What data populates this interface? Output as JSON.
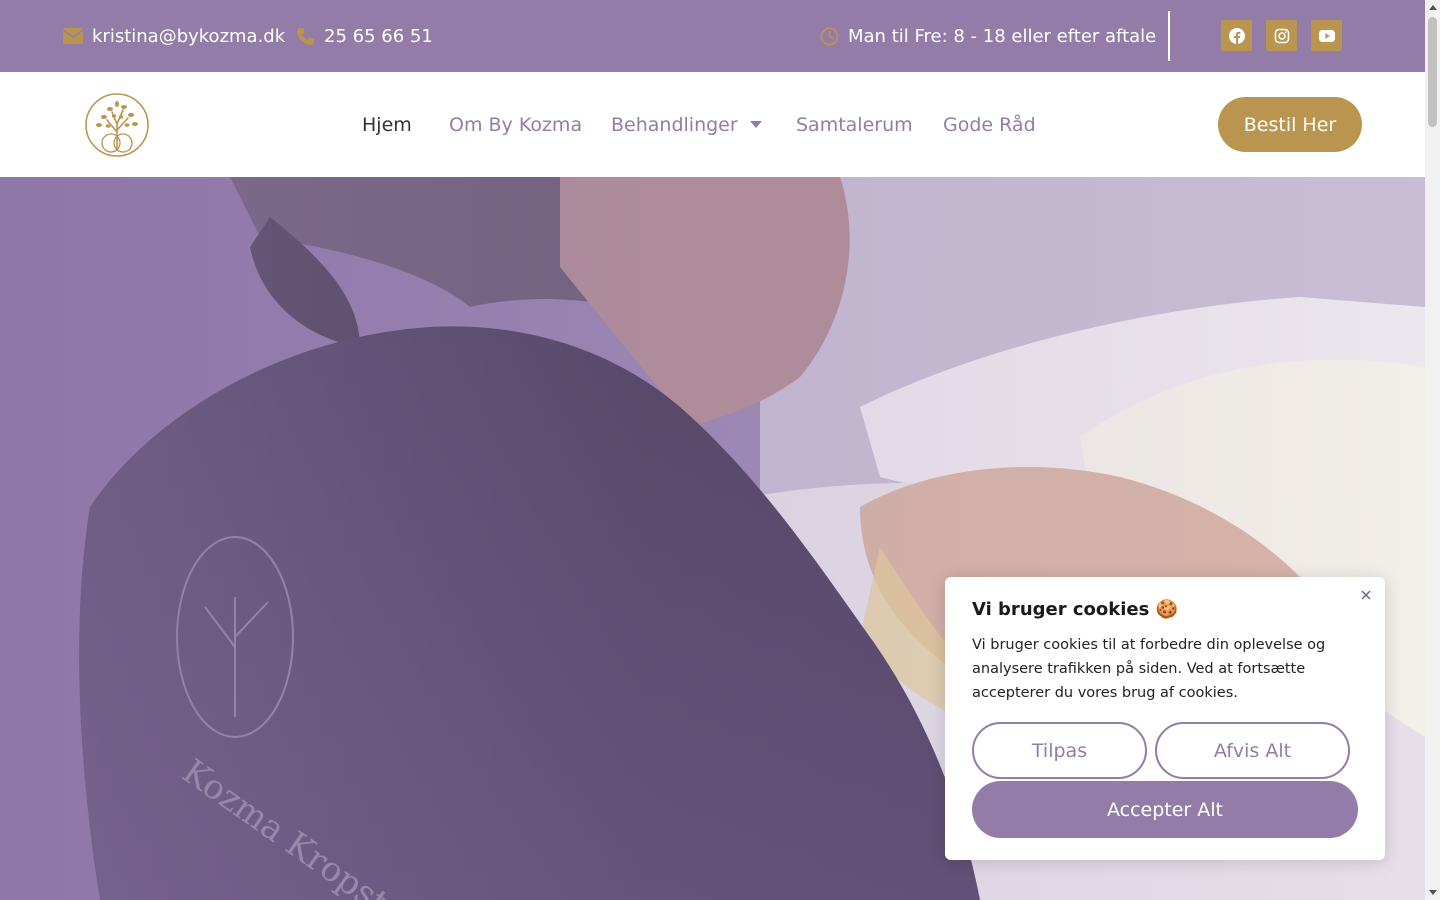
{
  "topbar": {
    "email": "kristina@bykozma.dk",
    "phone": "25 65 66 51",
    "hours": "Man til Fre: 8 - 18 eller efter aftale",
    "social": [
      "facebook-icon",
      "instagram-icon",
      "youtube-icon"
    ]
  },
  "nav": {
    "items": [
      {
        "label": "Hjem",
        "active": true
      },
      {
        "label": "Om By Kozma"
      },
      {
        "label": "Behandlinger",
        "has_dropdown": true
      },
      {
        "label": "Samtalerum"
      },
      {
        "label": "Gode Råd"
      }
    ],
    "cta": "Bestil Her"
  },
  "cookie": {
    "title": "Vi bruger cookies 🍪",
    "text": "Vi bruger cookies til at forbedre din oplevelse og analysere trafikken på siden. Ved at fortsætte accepterer du vores brug af cookies.",
    "customize": "Tilpas",
    "reject": "Afvis Alt",
    "accept": "Accepter Alt"
  },
  "colors": {
    "primary": "#937ca8",
    "accent": "#b9954f",
    "text_dark": "#333333"
  }
}
